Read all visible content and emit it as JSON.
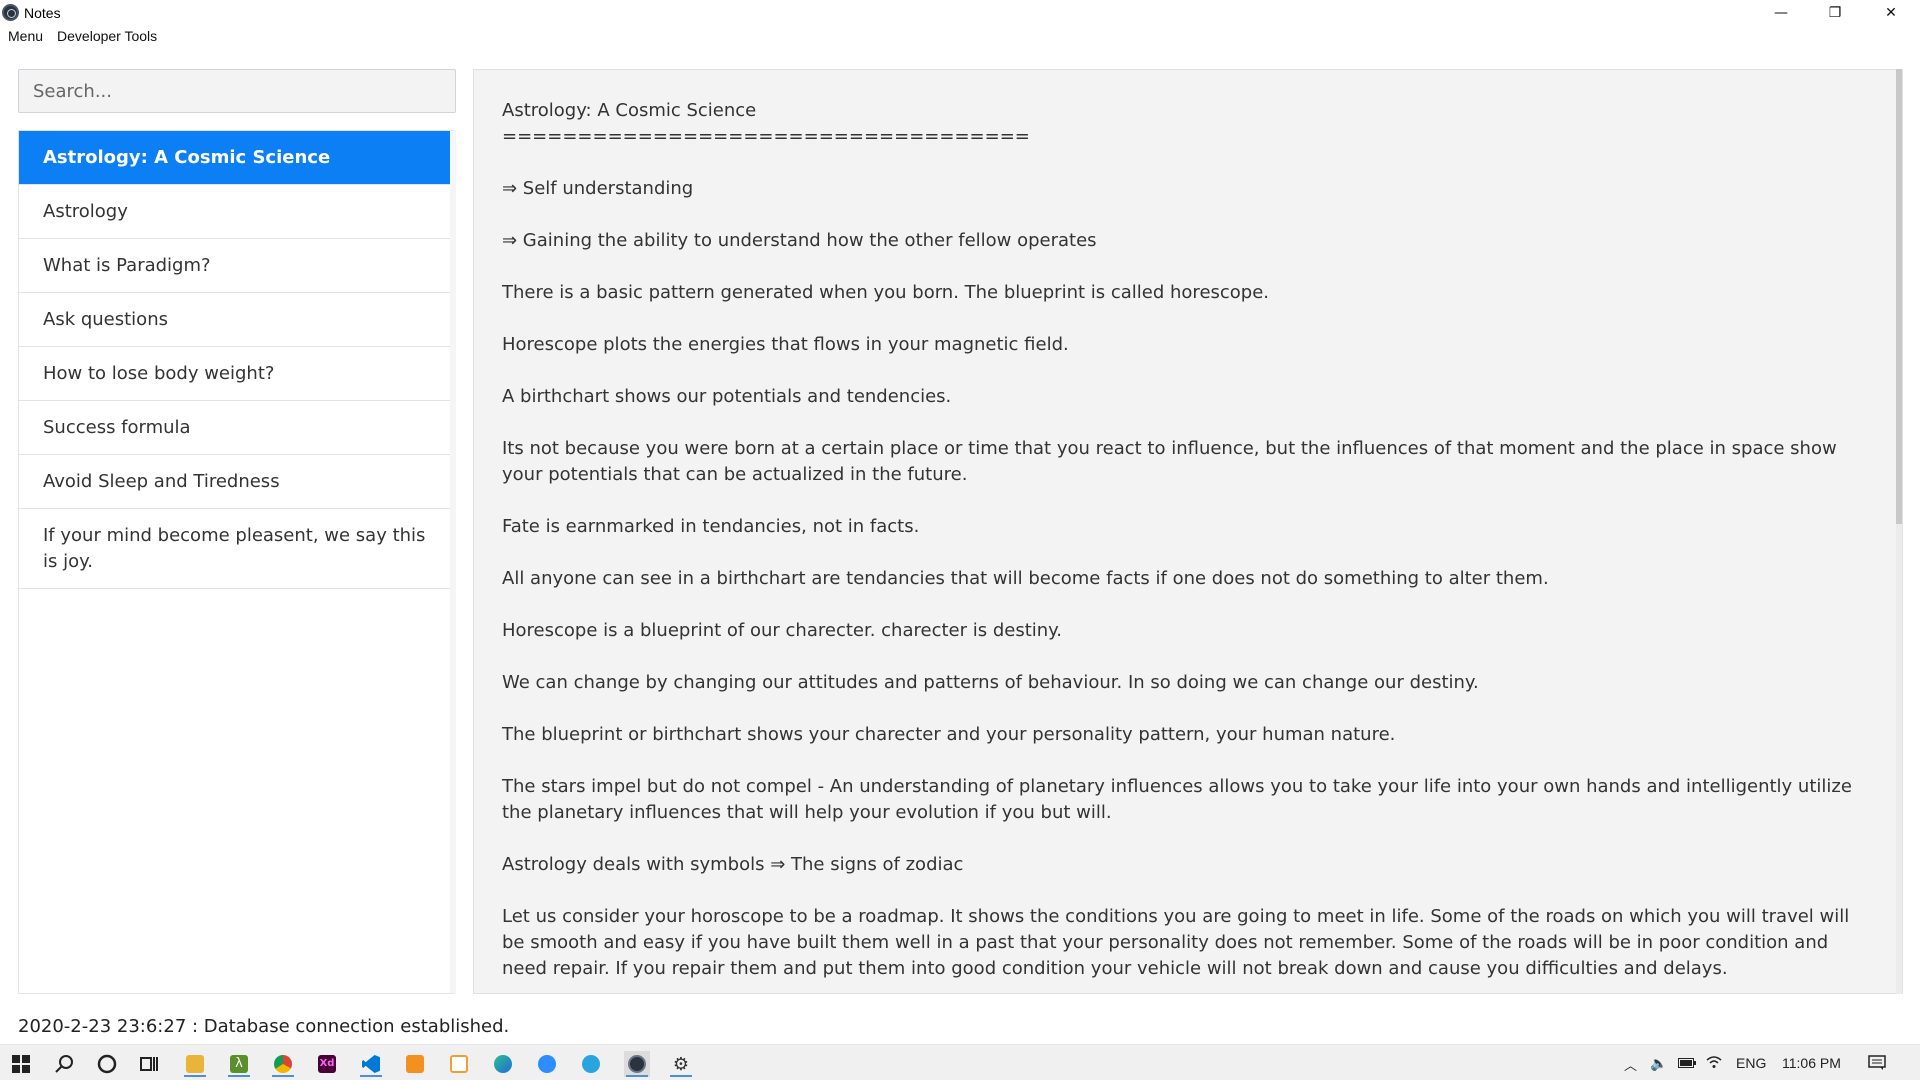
{
  "window": {
    "title": "Notes",
    "minimize_glyph": "—",
    "maximize_glyph": "❐",
    "close_glyph": "✕"
  },
  "menu": {
    "items": [
      "Menu",
      "Developer Tools"
    ]
  },
  "search": {
    "placeholder": "Search..."
  },
  "notes_list": [
    {
      "title": "Astrology: A Cosmic Science",
      "selected": true
    },
    {
      "title": "Astrology",
      "selected": false
    },
    {
      "title": "What is Paradigm?",
      "selected": false
    },
    {
      "title": "Ask questions",
      "selected": false
    },
    {
      "title": "How to lose body weight?",
      "selected": false
    },
    {
      "title": "Success formula",
      "selected": false
    },
    {
      "title": "Avoid Sleep and Tiredness",
      "selected": false
    },
    {
      "title": "If your mind become pleasent, we say this is joy.",
      "selected": false
    }
  ],
  "note": {
    "title": "Astrology: A Cosmic Science",
    "underline": "===================================",
    "paragraphs": [
      "⇒ Self understanding",
      "⇒ Gaining the ability to understand how the other fellow operates",
      "There is a basic pattern generated when you born. The blueprint is called horescope.",
      "Horescope plots the energies that flows in your magnetic field.",
      "A birthchart shows our potentials and tendencies.",
      "Its not because you were born at a certain place or time that you react to influence, but the influences of that moment and the place in space show your potentials that can be actualized in the future.",
      "Fate is earnmarked in tendancies, not in facts.",
      "All anyone can see in a birthchart are tendancies that will become facts if one does not do something to alter them.",
      "Horescope is a blueprint of our charecter. charecter is destiny.",
      "We can change by changing our attitudes and patterns of behaviour. In so doing we can change our destiny.",
      "The blueprint or birthchart shows your charecter and your personality pattern, your human nature.",
      "The stars impel but do not compel - An understanding of planetary influences allows you to take your life into your own hands and intelligently utilize the planetary influences that will help your evolution if you but will.",
      "Astrology deals with symbols ⇒ The signs of zodiac",
      "Let us consider your horoscope to be a roadmap. It shows the conditions you are going to meet in life. Some of the roads on which you will travel will be smooth and easy if you have built them well in a past that your personality does not remember. Some of the roads will be in poor condition and need repair. If you repair them and put them into good condition your vehicle will not break down and cause you difficulties and delays."
    ]
  },
  "status": {
    "message": "2020-2-23 23:6:27 : Database connection established."
  },
  "taskbar": {
    "apps": [
      {
        "name": "start-icon",
        "color": "#222222"
      },
      {
        "name": "search-icon",
        "color": "#222222"
      },
      {
        "name": "cortana-icon",
        "color": "#222222"
      },
      {
        "name": "task-view-icon",
        "color": "#222222"
      },
      {
        "name": "file-explorer-icon",
        "color": "#e8b43a"
      },
      {
        "name": "lambda-app-icon",
        "color": "#5a8f29"
      },
      {
        "name": "chrome-icon",
        "color": "#db4437"
      },
      {
        "name": "adobe-xd-icon",
        "color": "#470137"
      },
      {
        "name": "vscode-icon",
        "color": "#0078d4"
      },
      {
        "name": "sublime-icon",
        "color": "#f29020"
      },
      {
        "name": "orange-app-icon",
        "color": "#f0a030"
      },
      {
        "name": "edge-icon",
        "color": "#1e8e8e"
      },
      {
        "name": "zoom-icon",
        "color": "#2d8cff"
      },
      {
        "name": "telegram-icon",
        "color": "#2aa3df"
      },
      {
        "name": "notes-app-icon",
        "color": "#2b3340"
      },
      {
        "name": "settings-icon",
        "color": "#333333"
      }
    ],
    "tray": {
      "language": "ENG",
      "time": "11:06 PM"
    }
  }
}
